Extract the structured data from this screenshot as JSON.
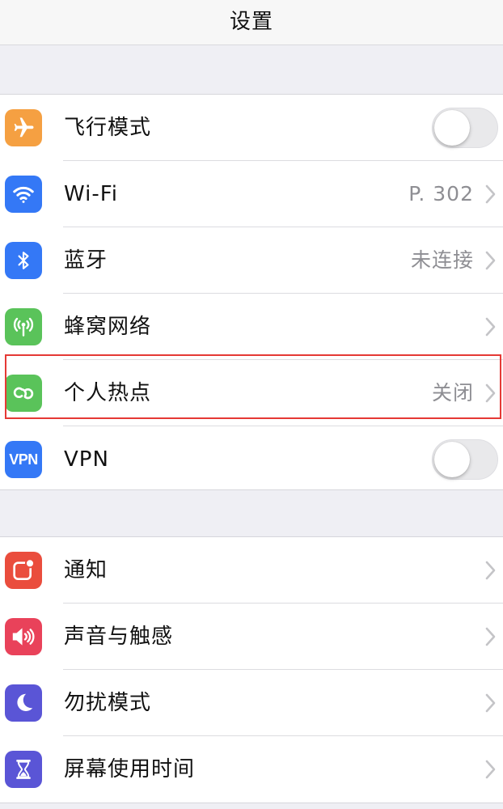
{
  "nav": {
    "title": "设置"
  },
  "colors": {
    "airplane": "#f5a042",
    "wifi": "#3478f6",
    "bluetooth": "#3478f6",
    "cellular": "#5ac35a",
    "hotspot": "#5ac35a",
    "vpn": "#3478f6",
    "notifications": "#ea4d3d",
    "sounds": "#e9425a",
    "dnd": "#5a55d6",
    "screentime": "#5a55d6",
    "highlight": "#e53935"
  },
  "group1": [
    {
      "label": "飞行模式",
      "icon": "airplane-icon",
      "accessory": "toggle",
      "on": false
    },
    {
      "label": "Wi-Fi",
      "icon": "wifi-icon",
      "value": "P. 302",
      "accessory": "chevron"
    },
    {
      "label": "蓝牙",
      "icon": "bluetooth-icon",
      "value": "未连接",
      "accessory": "chevron"
    },
    {
      "label": "蜂窝网络",
      "icon": "cellular-antenna-icon",
      "accessory": "chevron"
    },
    {
      "label": "个人热点",
      "icon": "hotspot-link-icon",
      "value": "关闭",
      "accessory": "chevron"
    },
    {
      "label": "VPN",
      "icon": "vpn-icon",
      "icon_text": "VPN",
      "accessory": "toggle",
      "on": false
    }
  ],
  "group2": [
    {
      "label": "通知",
      "icon": "notifications-icon",
      "accessory": "chevron"
    },
    {
      "label": "声音与触感",
      "icon": "speaker-icon",
      "accessory": "chevron"
    },
    {
      "label": "勿扰模式",
      "icon": "moon-icon",
      "accessory": "chevron"
    },
    {
      "label": "屏幕使用时间",
      "icon": "hourglass-icon",
      "accessory": "chevron"
    }
  ]
}
